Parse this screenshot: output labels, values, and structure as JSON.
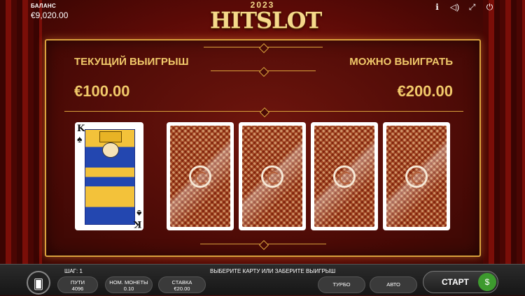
{
  "header": {
    "balance_label": "БАЛАНС",
    "balance_value": "€9,020.00",
    "logo_year": "2023",
    "logo_name": "HITSLOT",
    "icons": [
      "info-icon",
      "sound-icon",
      "fullscreen-icon",
      "power-icon"
    ]
  },
  "gamble": {
    "current_win_label": "ТЕКУЩИЙ ВЫИГРЫШ",
    "current_win_value": "€100.00",
    "possible_win_label": "МОЖНО ВЫИГРАТЬ",
    "possible_win_value": "€200.00",
    "dealer_card": {
      "rank": "K",
      "suit": "♠"
    },
    "hidden_cards_count": 4
  },
  "footer": {
    "step_label": "ШАГ: 1",
    "hint": "ВЫБЕРИТЕ КАРТУ ИЛИ ЗАБЕРИТЕ ВЫИГРЫШ",
    "paths_label": "ПУТИ",
    "paths_value": "4096",
    "coin_label": "НОМ. МОНЕТЫ",
    "coin_value": "0.10",
    "bet_label": "СТАВКА",
    "bet_value": "€20.00",
    "turbo_label": "ТУРБО",
    "auto_label": "АВТО",
    "start_label": "СТАРТ"
  },
  "colors": {
    "gold": "#f1c96a",
    "frame": "#d9a13c",
    "start_green": "#3d9a2e"
  }
}
